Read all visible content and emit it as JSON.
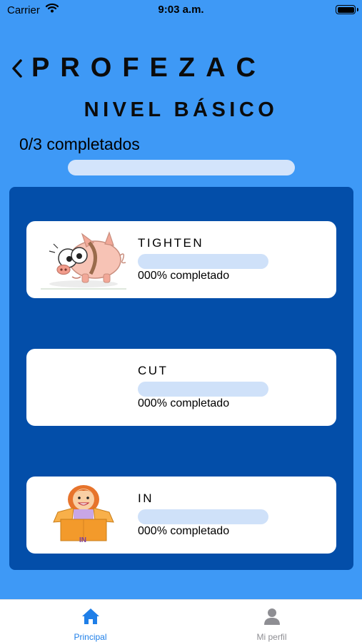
{
  "status_bar": {
    "carrier": "Carrier",
    "time": "9:03 a.m."
  },
  "header": {
    "title": "PROFEZAC",
    "back_icon": "chevron-left-icon"
  },
  "level": {
    "title": "NIVEL BÁSICO",
    "progress_text": "0/3 completados",
    "progress_fraction": 0
  },
  "lessons": [
    {
      "name": "TIGHTEN",
      "progress_text": "000% completado",
      "progress_fraction": 0,
      "image": "pig-illustration"
    },
    {
      "name": "CUT",
      "progress_text": "000% completado",
      "progress_fraction": 0,
      "image": "blank"
    },
    {
      "name": "IN",
      "progress_text": "000% completado",
      "progress_fraction": 0,
      "image": "girl-in-box-illustration",
      "image_caption": "IN"
    }
  ],
  "tab_bar": {
    "tabs": [
      {
        "label": "Principal",
        "icon": "home-icon",
        "active": true
      },
      {
        "label": "Mi perfil",
        "icon": "person-icon",
        "active": false
      }
    ]
  },
  "colors": {
    "background": "#3e99f6",
    "panel": "#034ea9",
    "card": "#ffffff",
    "progress_track": "#d3e4fb",
    "tab_active": "#1f7fe8",
    "tab_inactive": "#8e8e93"
  }
}
